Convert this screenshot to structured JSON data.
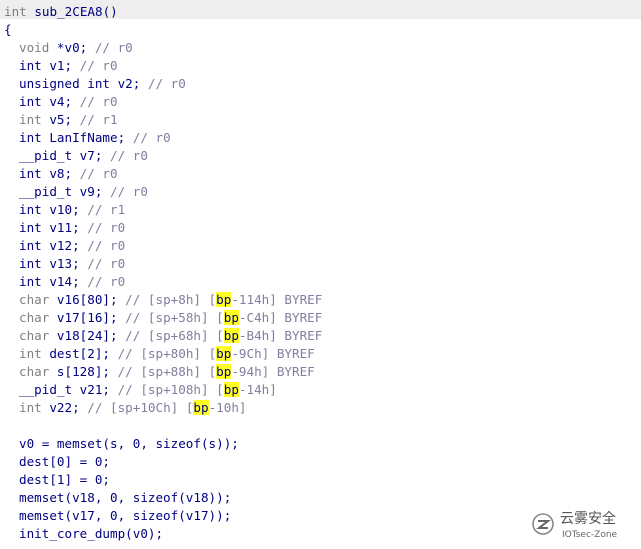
{
  "code": {
    "lines": [
      {
        "indent": 0,
        "tokens": [
          {
            "t": "int",
            "c": "g"
          },
          {
            "t": " sub_2CEA8()",
            "c": "n"
          }
        ]
      },
      {
        "indent": 0,
        "tokens": [
          {
            "t": "{",
            "c": "n"
          }
        ]
      },
      {
        "indent": 1,
        "tokens": [
          {
            "t": "void",
            "c": "g"
          },
          {
            "t": " *v0; ",
            "c": "n"
          },
          {
            "t": "// r0",
            "c": "c"
          }
        ]
      },
      {
        "indent": 1,
        "tokens": [
          {
            "t": "int v1; ",
            "c": "n"
          },
          {
            "t": "// r0",
            "c": "c"
          }
        ]
      },
      {
        "indent": 1,
        "tokens": [
          {
            "t": "unsigned int v2; ",
            "c": "n"
          },
          {
            "t": "// r0",
            "c": "c"
          }
        ]
      },
      {
        "indent": 1,
        "tokens": [
          {
            "t": "int v4; ",
            "c": "n"
          },
          {
            "t": "// r0",
            "c": "c"
          }
        ]
      },
      {
        "indent": 1,
        "tokens": [
          {
            "t": "int",
            "c": "g"
          },
          {
            "t": " v5; ",
            "c": "n"
          },
          {
            "t": "// r1",
            "c": "c"
          }
        ]
      },
      {
        "indent": 1,
        "tokens": [
          {
            "t": "int LanIfName; ",
            "c": "n"
          },
          {
            "t": "// r0",
            "c": "c"
          }
        ]
      },
      {
        "indent": 1,
        "tokens": [
          {
            "t": "__pid_t v7; ",
            "c": "n"
          },
          {
            "t": "// r0",
            "c": "c"
          }
        ]
      },
      {
        "indent": 1,
        "tokens": [
          {
            "t": "int v8; ",
            "c": "n"
          },
          {
            "t": "// r0",
            "c": "c"
          }
        ]
      },
      {
        "indent": 1,
        "tokens": [
          {
            "t": "__pid_t v9; ",
            "c": "n"
          },
          {
            "t": "// r0",
            "c": "c"
          }
        ]
      },
      {
        "indent": 1,
        "tokens": [
          {
            "t": "int v10; ",
            "c": "n"
          },
          {
            "t": "// r1",
            "c": "c"
          }
        ]
      },
      {
        "indent": 1,
        "tokens": [
          {
            "t": "int v11; ",
            "c": "n"
          },
          {
            "t": "// r0",
            "c": "c"
          }
        ]
      },
      {
        "indent": 1,
        "tokens": [
          {
            "t": "int v12; ",
            "c": "n"
          },
          {
            "t": "// r0",
            "c": "c"
          }
        ]
      },
      {
        "indent": 1,
        "tokens": [
          {
            "t": "int v13; ",
            "c": "n"
          },
          {
            "t": "// r0",
            "c": "c"
          }
        ]
      },
      {
        "indent": 1,
        "tokens": [
          {
            "t": "int v14; ",
            "c": "n"
          },
          {
            "t": "// r0",
            "c": "c"
          }
        ]
      },
      {
        "indent": 1,
        "tokens": [
          {
            "t": "char",
            "c": "g"
          },
          {
            "t": " v16[80]; ",
            "c": "n"
          },
          {
            "t": "// [sp+8h] [",
            "c": "c"
          },
          {
            "t": "bp",
            "c": "hl"
          },
          {
            "t": "-114h] BYREF",
            "c": "c"
          }
        ]
      },
      {
        "indent": 1,
        "tokens": [
          {
            "t": "char",
            "c": "g"
          },
          {
            "t": " v17[16]; ",
            "c": "n"
          },
          {
            "t": "// [sp+58h] [",
            "c": "c"
          },
          {
            "t": "bp",
            "c": "hl"
          },
          {
            "t": "-C4h] BYREF",
            "c": "c"
          }
        ]
      },
      {
        "indent": 1,
        "tokens": [
          {
            "t": "char",
            "c": "g"
          },
          {
            "t": " v18[24]; ",
            "c": "n"
          },
          {
            "t": "// [sp+68h] [",
            "c": "c"
          },
          {
            "t": "bp",
            "c": "hl"
          },
          {
            "t": "-B4h] BYREF",
            "c": "c"
          }
        ]
      },
      {
        "indent": 1,
        "tokens": [
          {
            "t": "int",
            "c": "g"
          },
          {
            "t": " dest[2]; ",
            "c": "n"
          },
          {
            "t": "// [sp+80h] [",
            "c": "c"
          },
          {
            "t": "bp",
            "c": "hl"
          },
          {
            "t": "-9Ch] BYREF",
            "c": "c"
          }
        ]
      },
      {
        "indent": 1,
        "tokens": [
          {
            "t": "char",
            "c": "g"
          },
          {
            "t": " s[128]; ",
            "c": "n"
          },
          {
            "t": "// [sp+88h] [",
            "c": "c"
          },
          {
            "t": "bp",
            "c": "hl"
          },
          {
            "t": "-94h] BYREF",
            "c": "c"
          }
        ]
      },
      {
        "indent": 1,
        "tokens": [
          {
            "t": "__pid_t v21; ",
            "c": "n"
          },
          {
            "t": "// [sp+108h] [",
            "c": "c"
          },
          {
            "t": "bp",
            "c": "hl"
          },
          {
            "t": "-14h]",
            "c": "c"
          }
        ]
      },
      {
        "indent": 1,
        "tokens": [
          {
            "t": "int",
            "c": "g"
          },
          {
            "t": " v22; ",
            "c": "n"
          },
          {
            "t": "// [sp+10Ch] [",
            "c": "c"
          },
          {
            "t": "bp",
            "c": "hl"
          },
          {
            "t": "-10h]",
            "c": "c"
          }
        ]
      },
      {
        "indent": 1,
        "tokens": []
      },
      {
        "indent": 1,
        "tokens": [
          {
            "t": "v0 = memset(s, 0, sizeof(s));",
            "c": "n"
          }
        ]
      },
      {
        "indent": 1,
        "tokens": [
          {
            "t": "dest[0] = 0;",
            "c": "n"
          }
        ]
      },
      {
        "indent": 1,
        "tokens": [
          {
            "t": "dest[1] = 0;",
            "c": "n"
          }
        ]
      },
      {
        "indent": 1,
        "tokens": [
          {
            "t": "memset(v18, 0, sizeof(v18));",
            "c": "n"
          }
        ]
      },
      {
        "indent": 1,
        "tokens": [
          {
            "t": "memset(v17, 0, sizeof(v17));",
            "c": "n"
          }
        ]
      },
      {
        "indent": 1,
        "tokens": [
          {
            "t": "init_core_dump(v0);",
            "c": "n"
          }
        ]
      }
    ]
  },
  "watermark": {
    "title": "云雾安全",
    "subtitle": "IOTsec-Zone",
    "logo_icon": "wechat-account-logo-icon"
  },
  "colors": {
    "keyword": "#808080",
    "identifier": "#000080",
    "comment": "#7f7f9f",
    "highlight": "#ffff22",
    "header_bar": "#eeeeee"
  }
}
